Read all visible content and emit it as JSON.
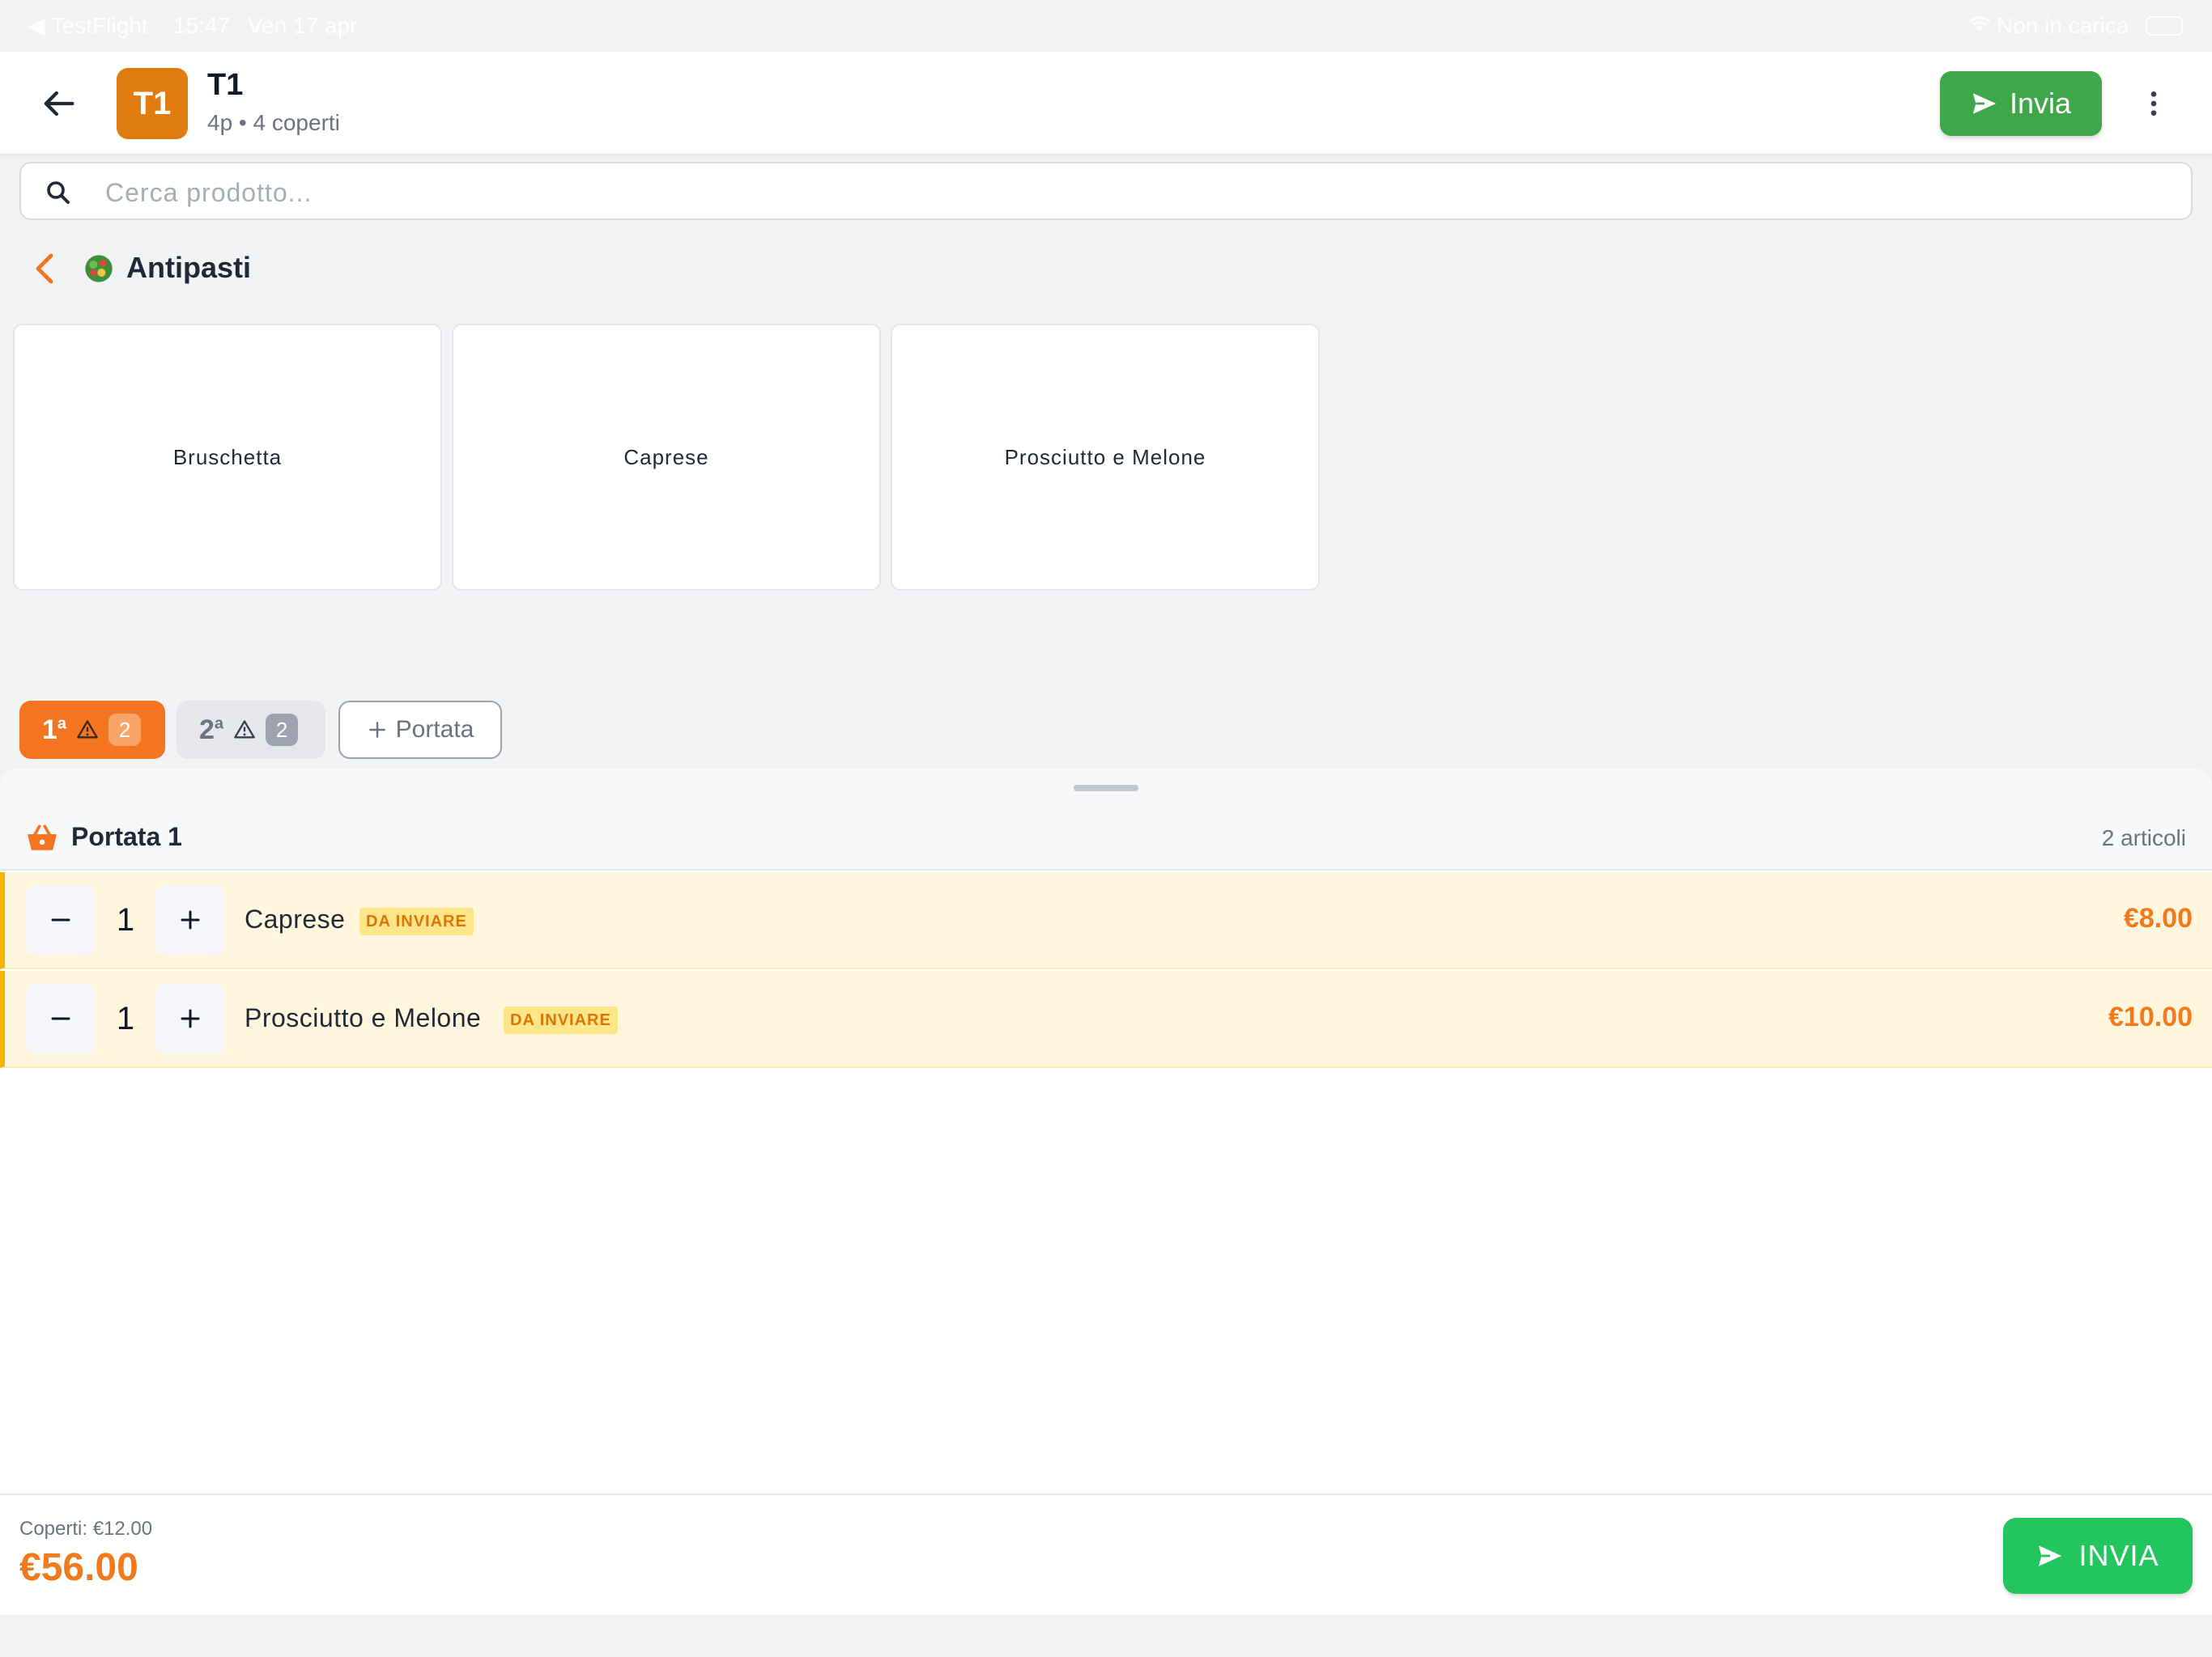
{
  "status_bar": {
    "back_app": "◀ TestFlight",
    "time": "15:47",
    "date": "Ven 17 apr",
    "charging": "Non in carica"
  },
  "header": {
    "avatar_text": "T1",
    "title": "T1",
    "subtitle": "4p • 4 coperti",
    "send_label": "Invia"
  },
  "search": {
    "placeholder": "Cerca prodotto..."
  },
  "category": {
    "title": "Antipasti"
  },
  "products": [
    {
      "name": "Bruschetta"
    },
    {
      "name": "Caprese"
    },
    {
      "name": "Prosciutto e Melone"
    }
  ],
  "course_tabs": [
    {
      "num": "1",
      "sup": "a",
      "badge": "2"
    },
    {
      "num": "2",
      "sup": "a",
      "badge": "2"
    }
  ],
  "add_course_label": "Portata",
  "order": {
    "course_title": "Portata 1",
    "count_label": "2 articoli",
    "items": [
      {
        "qty": "1",
        "name": "Caprese",
        "status": "DA INVIARE",
        "price": "€8.00"
      },
      {
        "qty": "1",
        "name": "Prosciutto e Melone",
        "status": "DA INVIARE",
        "price": "€10.00"
      }
    ]
  },
  "footer": {
    "covers": "Coperti: €12.00",
    "total": "€56.00",
    "send_label": "INVIA"
  },
  "colors": {
    "accent": "#f47420",
    "send_green": "#3fa74a",
    "pending_bg": "#fff6dd"
  }
}
